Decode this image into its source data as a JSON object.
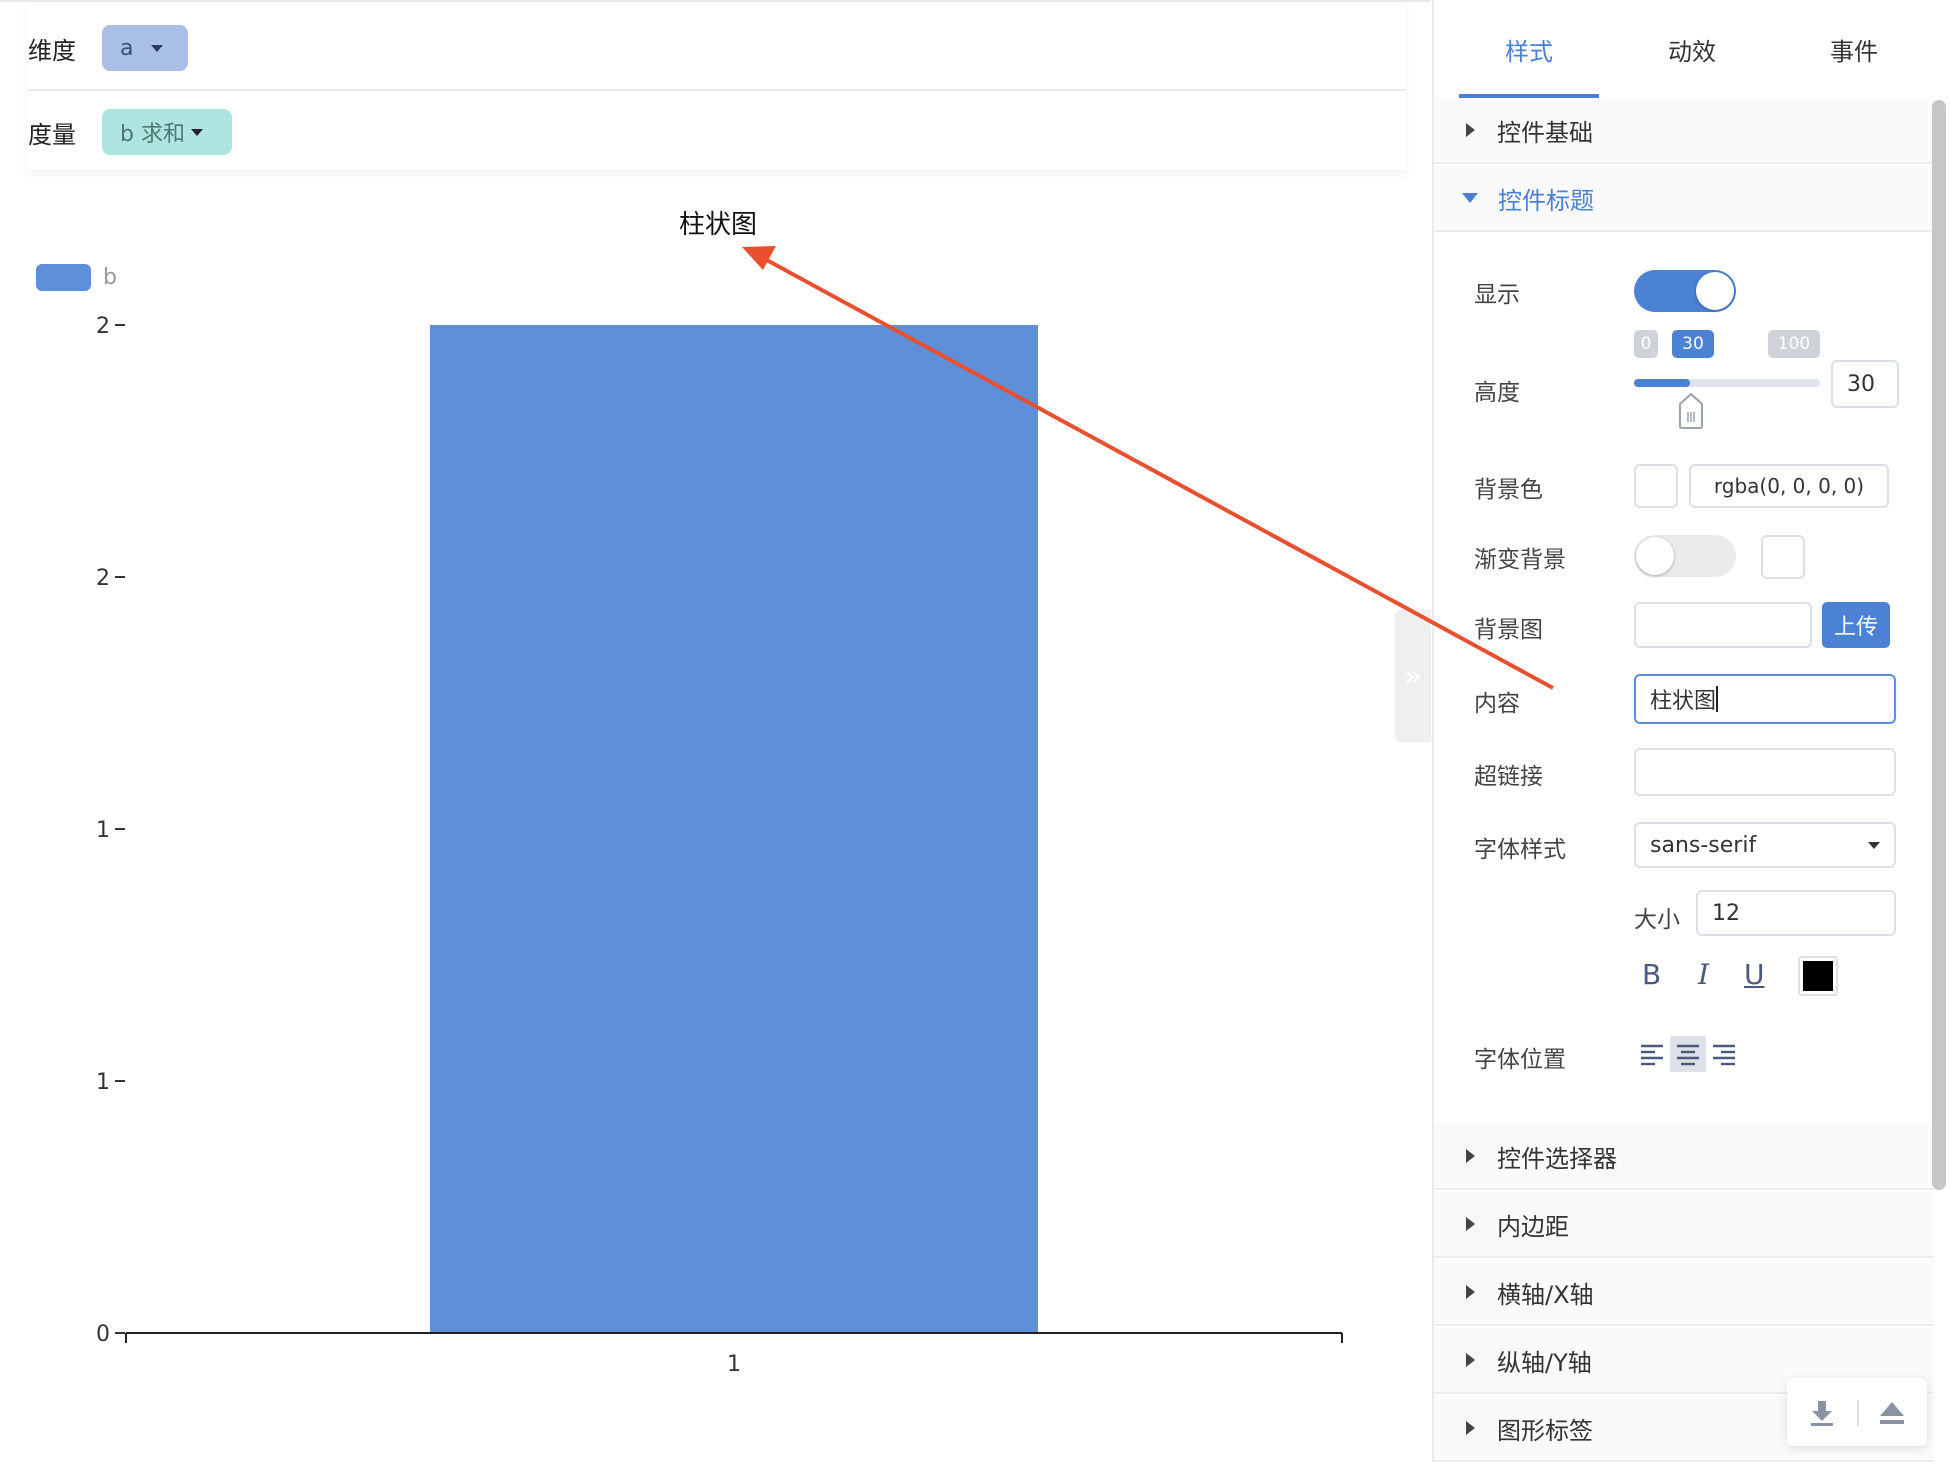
{
  "fields": {
    "dimension_label": "维度",
    "dimension_chip": "a",
    "measure_label": "度量",
    "measure_chip": "b 求和"
  },
  "chart_data": {
    "type": "bar",
    "title": "柱状图",
    "categories": [
      "1"
    ],
    "series": [
      {
        "name": "b",
        "values": [
          2
        ]
      }
    ],
    "ytick_labels": [
      "0",
      "1",
      "1",
      "2",
      "2"
    ],
    "ytick_values": [
      0,
      0.5,
      1,
      1.5,
      2
    ],
    "ylim": [
      0,
      2
    ],
    "xlabel": "",
    "ylabel": "",
    "color": "#5f8fd9",
    "legend": "top-left",
    "grid": false
  },
  "tabs": [
    "样式",
    "动效",
    "事件"
  ],
  "active_tab": "样式",
  "sections": {
    "basic": "控件基础",
    "title": "控件标题",
    "selector": "控件选择器",
    "padding": "内边距",
    "xaxis": "横轴/X轴",
    "yaxis": "纵轴/Y轴",
    "label": "图形标签"
  },
  "form": {
    "show_label": "显示",
    "show_on": true,
    "height_label": "高度",
    "height_min": "0",
    "height_current": "30",
    "height_max": "100",
    "height_value": "30",
    "height_fraction": 0.3,
    "bg_color_label": "背景色",
    "bg_color_value": "rgba(0, 0, 0, 0)",
    "gradient_label": "渐变背景",
    "gradient_on": false,
    "bg_image_label": "背景图",
    "upload_label": "上传",
    "content_label": "内容",
    "content_value": "柱状图",
    "link_label": "超链接",
    "link_value": "",
    "font_style_label": "字体样式",
    "font_family_value": "sans-serif",
    "size_label": "大小",
    "size_value": "12",
    "bold": "B",
    "italic": "I",
    "underline": "U",
    "font_color": "#000000",
    "font_position_label": "字体位置",
    "font_position": "center"
  },
  "colors": {
    "accent": "#4b82d4",
    "annotation": "#e8502f"
  },
  "icons": {
    "collapse": "double-chevron-right-icon",
    "download": "download-icon",
    "eject": "eject-icon"
  }
}
